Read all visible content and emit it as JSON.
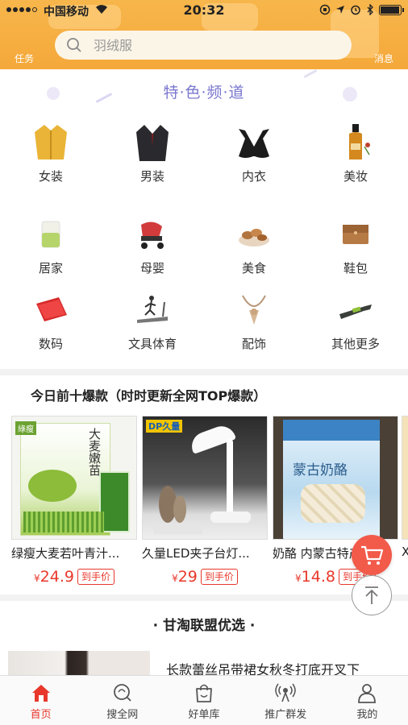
{
  "status_bar": {
    "carrier": "中国移动",
    "time": "20:32",
    "battery_level": 0.95,
    "signal_bars": 4
  },
  "header": {
    "left_label": "任务",
    "right_label": "消息",
    "search_placeholder": "羽绒服",
    "accent_color": "#f5a83a"
  },
  "channels": {
    "title": "特·色·频·道",
    "items": [
      {
        "label": "女装",
        "icon": "sweater-icon"
      },
      {
        "label": "男装",
        "icon": "suit-icon"
      },
      {
        "label": "内衣",
        "icon": "bra-icon"
      },
      {
        "label": "美妆",
        "icon": "perfume-icon"
      },
      {
        "label": "居家",
        "icon": "cup-icon"
      },
      {
        "label": "母婴",
        "icon": "stroller-icon"
      },
      {
        "label": "美食",
        "icon": "snacks-icon"
      },
      {
        "label": "鞋包",
        "icon": "wallet-icon"
      },
      {
        "label": "数码",
        "icon": "phone-case-icon"
      },
      {
        "label": "文具体育",
        "icon": "treadmill-icon"
      },
      {
        "label": "配饰",
        "icon": "necklace-icon"
      },
      {
        "label": "其他更多",
        "icon": "tool-icon"
      }
    ]
  },
  "topten": {
    "title": "今日前十爆款（时时更新全网TOP爆款）",
    "products": [
      {
        "name": "绿瘦大麦若叶青汁...",
        "currency": "¥",
        "price": "24.9",
        "tag": "到手价",
        "box_brand": "綠瘦",
        "box_text": "大麦嫩苗"
      },
      {
        "name": "久量LED夹子台灯...",
        "currency": "¥",
        "price": "29",
        "tag": "到手价",
        "box_brand": "DP久量"
      },
      {
        "name": "奶酪 内蒙古特产...",
        "currency": "¥",
        "price": "14.8",
        "tag": "到手价",
        "box_text": "蒙古奶酪"
      },
      {
        "name": "X",
        "currency": "",
        "price": "",
        "tag": ""
      }
    ],
    "price_color": "#e8382b"
  },
  "preferred": {
    "title": "· 甘淘联盟优选 ·",
    "first_item_name": "长款蕾丝吊带裙女秋冬打底开叉下"
  },
  "tabbar": {
    "active_color": "#e8382b",
    "tabs": [
      {
        "label": "首页",
        "icon": "home-icon",
        "active": true
      },
      {
        "label": "搜全网",
        "icon": "search-globe-icon",
        "active": false
      },
      {
        "label": "好单库",
        "icon": "shopping-bag-icon",
        "active": false
      },
      {
        "label": "推广群发",
        "icon": "broadcast-icon",
        "active": false
      },
      {
        "label": "我的",
        "icon": "user-icon",
        "active": false
      }
    ]
  }
}
